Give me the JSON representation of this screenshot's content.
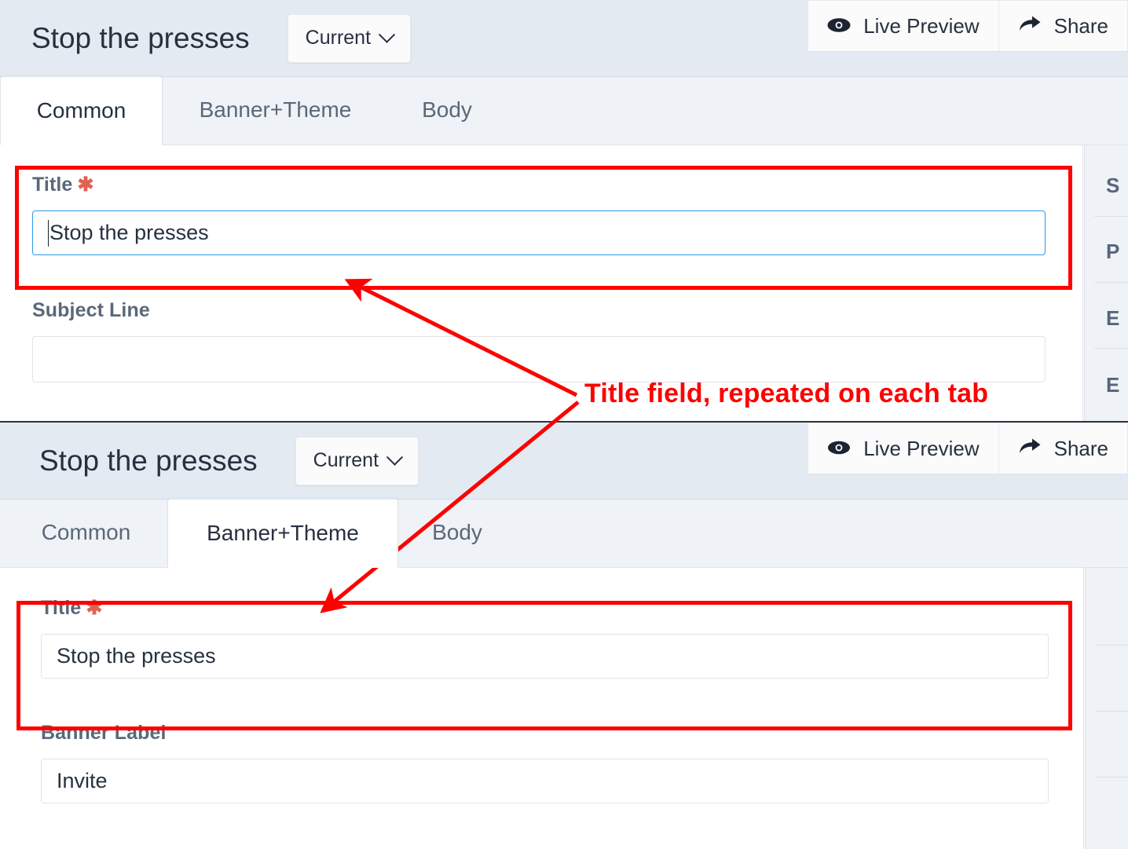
{
  "annotation": {
    "text": "Title field, repeated on each tab",
    "color": "#fe0000"
  },
  "panels": [
    {
      "id": "common-panel",
      "header": {
        "doc_title": "Stop the presses",
        "version_selector": {
          "label": "Current",
          "icon": "chevron-down-icon"
        },
        "actions": [
          {
            "label": "Live Preview",
            "icon": "eye-icon"
          },
          {
            "label": "Share",
            "icon": "share-arrow-icon"
          }
        ]
      },
      "tabs": [
        {
          "label": "Common",
          "active": true
        },
        {
          "label": "Banner+Theme",
          "active": false
        },
        {
          "label": "Body",
          "active": false
        }
      ],
      "fields": [
        {
          "label": "Title",
          "required": true,
          "value": "Stop the presses",
          "focused": true,
          "placeholder": ""
        },
        {
          "label": "Subject Line",
          "required": false,
          "value": "",
          "focused": false,
          "placeholder": ""
        }
      ],
      "side_rows": [
        "S",
        "P",
        "E",
        "E"
      ]
    },
    {
      "id": "banner-theme-panel",
      "header": {
        "doc_title": "Stop the presses",
        "version_selector": {
          "label": "Current",
          "icon": "chevron-down-icon"
        },
        "actions": [
          {
            "label": "Live Preview",
            "icon": "eye-icon"
          },
          {
            "label": "Share",
            "icon": "share-arrow-icon"
          }
        ]
      },
      "tabs": [
        {
          "label": "Common",
          "active": false
        },
        {
          "label": "Banner+Theme",
          "active": true
        },
        {
          "label": "Body",
          "active": false
        }
      ],
      "fields": [
        {
          "label": "Title",
          "required": true,
          "value": "Stop the presses",
          "focused": false,
          "placeholder": ""
        },
        {
          "label": "Banner Label",
          "required": false,
          "value": "Invite",
          "focused": false,
          "placeholder": ""
        }
      ],
      "side_rows": [
        "",
        "",
        "",
        ""
      ]
    }
  ],
  "colors": {
    "header_bg": "#e3eaf2",
    "tabstrip_bg": "#eff2f6",
    "accent_focus": "#2b9ae8",
    "required_star": "#e06253",
    "annotation": "#fe0000",
    "text_dark": "#26313f",
    "label_gray": "#5a6878"
  }
}
